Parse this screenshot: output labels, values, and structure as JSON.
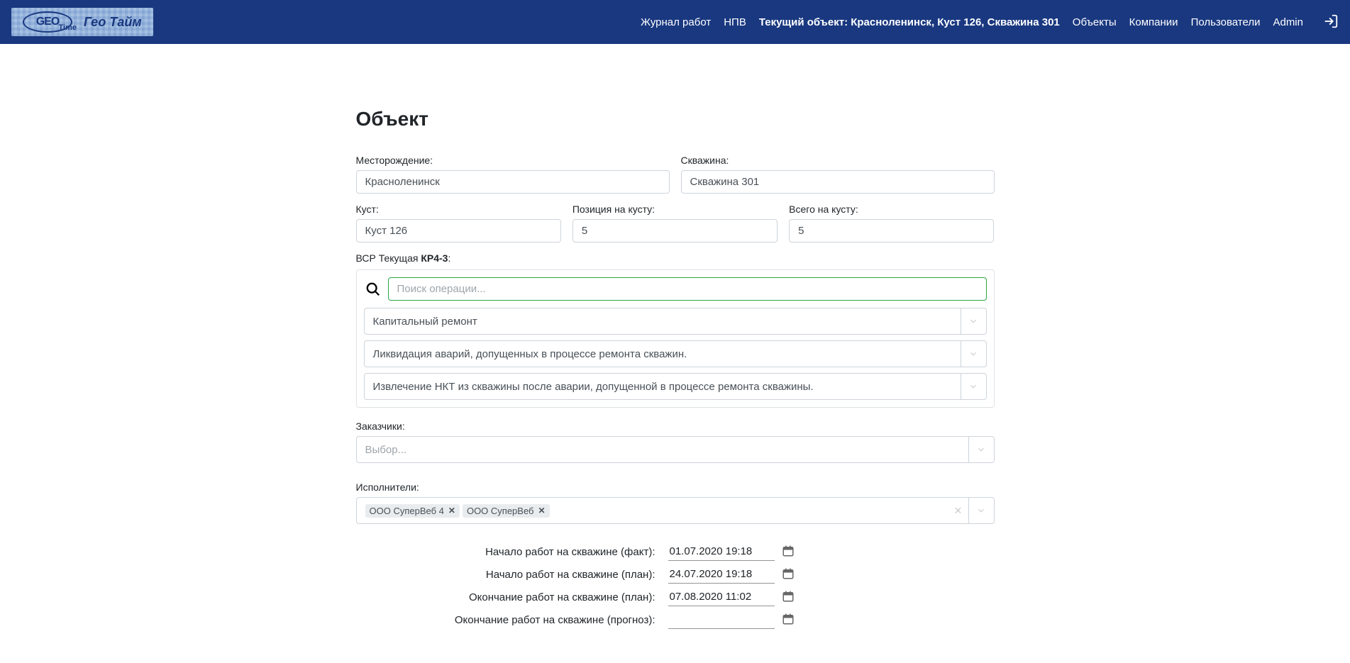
{
  "nav": {
    "brand_geo": "GEO",
    "brand_time": "Time",
    "brand_ru": "Гео Тайм",
    "links": {
      "journal": "Журнал работ",
      "npv": "НПВ",
      "current": "Текущий объект: Красноленинск, Куст 126, Скважина 301",
      "objects": "Объекты",
      "companies": "Компании",
      "users": "Пользователи",
      "admin": "Admin"
    }
  },
  "page": {
    "title": "Объект",
    "fields": {
      "field_label": "Месторождение:",
      "field_value": "Красноленинск",
      "well_label": "Скважина:",
      "well_value": "Скважина 301",
      "bush_label": "Куст:",
      "bush_value": "Куст 126",
      "pos_label": "Позиция на кусту:",
      "pos_value": "5",
      "total_label": "Всего на кусту:",
      "total_value": "5"
    },
    "bsr": {
      "label_prefix": "ВСР Текущая ",
      "label_bold": "КР4-3",
      "label_suffix": ":",
      "search_placeholder": "Поиск операции...",
      "select1": "Капитальный ремонт",
      "select2": "Ликвидация аварий, допущенных в процессе ремонта скважин.",
      "select3": "Извлечение НКТ из скважины после аварии, допущенной в процессе ремонта скважины."
    },
    "customers": {
      "label": "Заказчики:",
      "placeholder": "Выбор..."
    },
    "executors": {
      "label": "Исполнители:",
      "tag1": "ООО СуперВеб 4",
      "tag2": "ООО СуперВеб"
    },
    "dates": {
      "start_fact_label": "Начало работ на скважине (факт):",
      "start_fact_value": "01.07.2020 19:18",
      "start_plan_label": "Начало работ на скважине (план):",
      "start_plan_value": "24.07.2020 19:18",
      "end_plan_label": "Окончание работ на скважине (план):",
      "end_plan_value": "07.08.2020 11:02",
      "end_forecast_label": "Окончание работ на скважине (прогноз):"
    }
  }
}
